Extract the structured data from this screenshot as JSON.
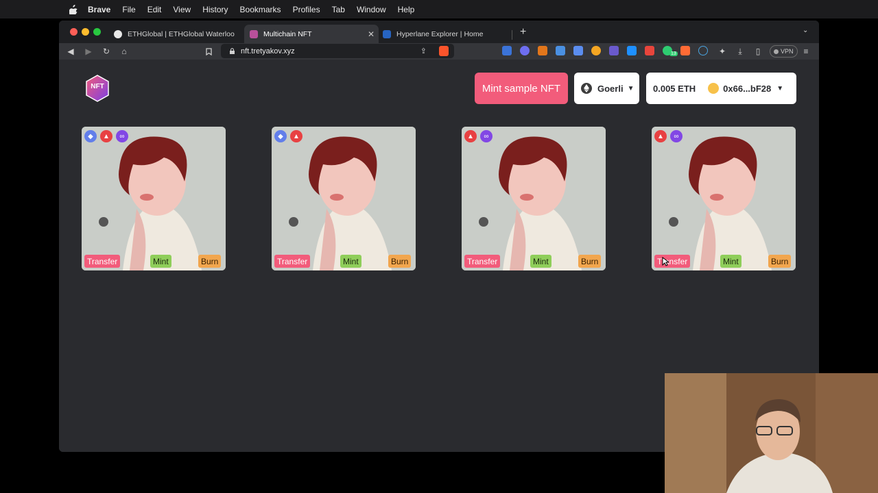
{
  "menubar": {
    "app_name": "Brave",
    "items": [
      "File",
      "Edit",
      "View",
      "History",
      "Bookmarks",
      "Profiles",
      "Tab",
      "Window",
      "Help"
    ]
  },
  "browser": {
    "tabs": [
      {
        "title": "ETHGlobal | ETHGlobal Waterloo",
        "active": false
      },
      {
        "title": "Multichain NFT",
        "active": true
      },
      {
        "title": "Hyperlane Explorer | Home",
        "active": false
      }
    ],
    "url": "nft.tretyakov.xyz",
    "vpn_label": "VPN",
    "extension_badge": "13"
  },
  "header": {
    "logo_text": "NFT",
    "mint_sample_label": "Mint sample NFT",
    "network_label": "Goerli",
    "balance": "0.005 ETH",
    "address": "0x66...bF28"
  },
  "cards": [
    {
      "chains": [
        "ethereum-icon",
        "avalanche-icon",
        "polygon-icon"
      ],
      "transfer": "Transfer",
      "mint": "Mint",
      "burn": "Burn"
    },
    {
      "chains": [
        "ethereum-icon",
        "avalanche-icon"
      ],
      "transfer": "Transfer",
      "mint": "Mint",
      "burn": "Burn"
    },
    {
      "chains": [
        "avalanche-icon",
        "polygon-icon"
      ],
      "transfer": "Transfer",
      "mint": "Mint",
      "burn": "Burn"
    },
    {
      "chains": [
        "avalanche-icon",
        "polygon-icon"
      ],
      "transfer": "Transfer",
      "mint": "Mint",
      "burn": "Burn"
    }
  ],
  "colors": {
    "accent_pink": "#f25c7b",
    "mint_green": "#8fce5a",
    "burn_orange": "#f2a64e",
    "page_bg": "#2a2b2f",
    "ethereum": "#627eea",
    "avalanche": "#e84142",
    "polygon": "#8247e5"
  }
}
